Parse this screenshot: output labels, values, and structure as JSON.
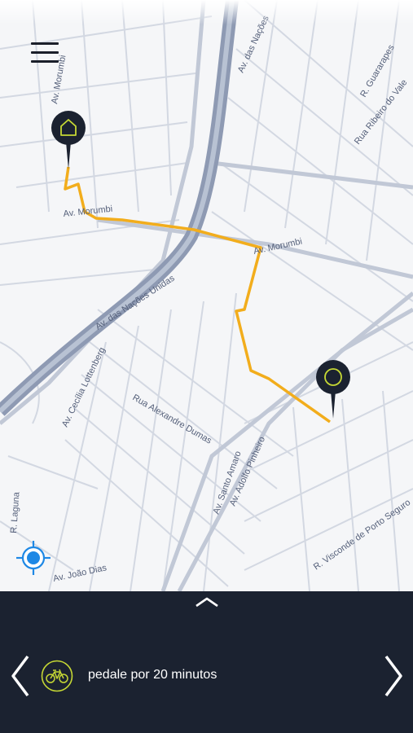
{
  "map": {
    "street_labels": [
      "Av. Morumbi",
      "Av. Morumbi",
      "Av. Morumbi",
      "Av. das Nações Unidas",
      "Av. das Nações",
      "Av. Cecília Lottenberg",
      "Rua Alexandre Dumas",
      "Av. Santo Amaro",
      "Av. Adolfo Pinheiro",
      "R. Laguna",
      "Av. João Dias",
      "R. Guararapes",
      "Rua Ribeiro do Vale",
      "R. Visconde de Porto Seguro"
    ],
    "route_color": "#f2ad1c",
    "pin_color": "#1b2230",
    "origin_icon": "home-icon",
    "destination_icon": "circle-icon"
  },
  "controls": {
    "menu_icon": "hamburger-menu-icon",
    "locate_icon": "location-target-icon",
    "locate_color": "#1e88e5"
  },
  "bottom_panel": {
    "background": "#1b2230",
    "expand_icon": "chevron-up-icon",
    "prev_icon": "chevron-left-icon",
    "next_icon": "chevron-right-icon",
    "mode_icon": "bicycle-icon",
    "mode_icon_color": "#c6d834",
    "mode_text": "pedale por 20 minutos"
  }
}
